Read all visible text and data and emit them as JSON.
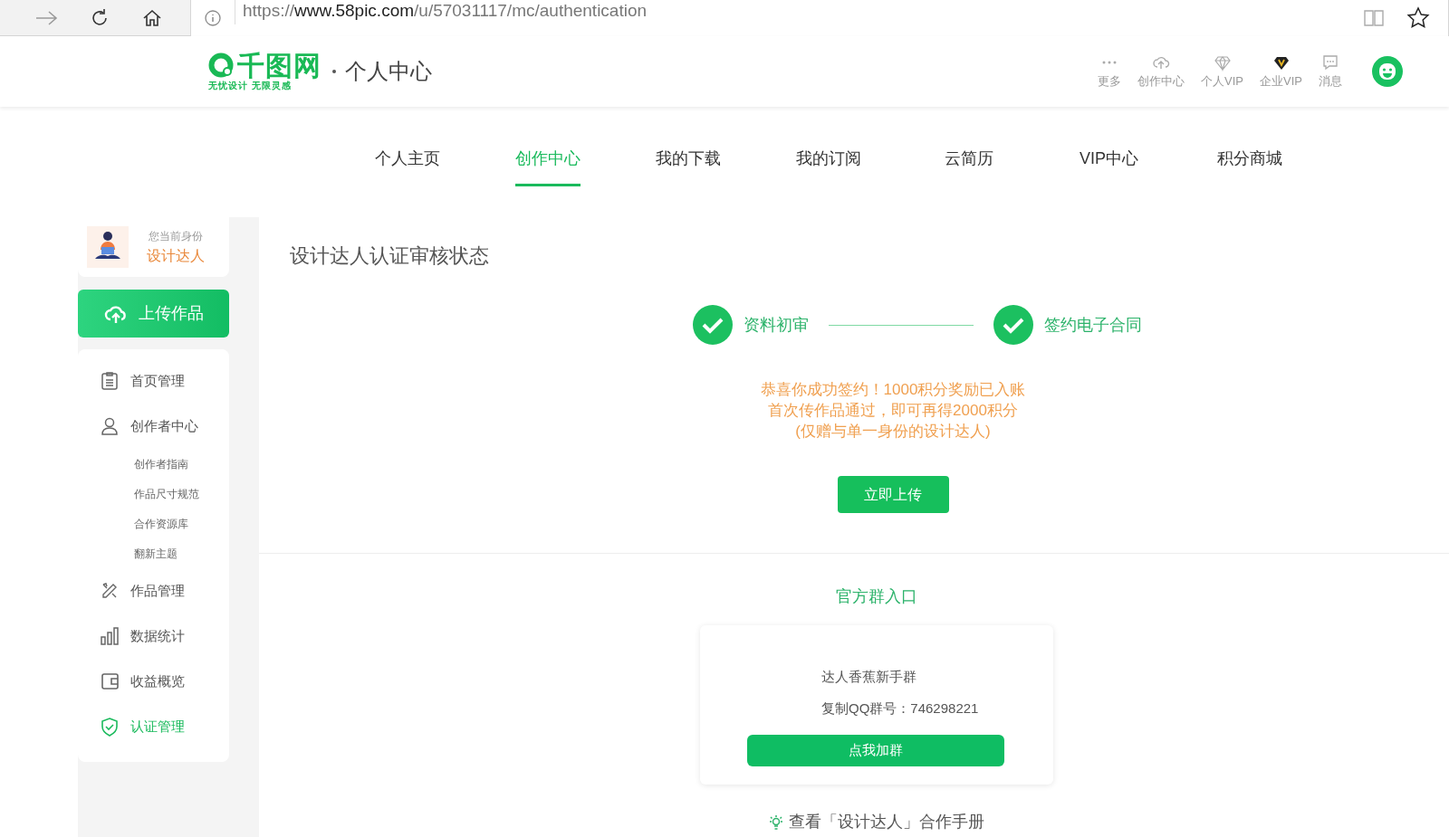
{
  "browser": {
    "url_prefix": "https://",
    "url_host": "www.58pic.com",
    "url_path": "/u/57031117/mc/authentication"
  },
  "header": {
    "logo": "千图网",
    "tagline": "无忧设计 无限灵感",
    "section": "个人中心",
    "actions": [
      {
        "kind": "more",
        "label": "更多"
      },
      {
        "kind": "upload",
        "label": "创作中心"
      },
      {
        "kind": "diamond",
        "label": "个人VIP"
      },
      {
        "kind": "vip",
        "label": "企业VIP"
      },
      {
        "kind": "message",
        "label": "消息"
      }
    ]
  },
  "tabs": [
    {
      "label": "个人主页",
      "selected": false
    },
    {
      "label": "创作中心",
      "selected": true
    },
    {
      "label": "我的下载",
      "selected": false
    },
    {
      "label": "我的订阅",
      "selected": false
    },
    {
      "label": "云简历",
      "selected": false
    },
    {
      "label": "VIP中心",
      "selected": false
    },
    {
      "label": "积分商城",
      "selected": false
    }
  ],
  "sidebar": {
    "identity_label": "您当前身份",
    "identity": "设计达人",
    "upload_button": "上传作品",
    "items": [
      {
        "kind": "clipboard",
        "label": "首页管理",
        "selected": false
      },
      {
        "kind": "user",
        "label": "创作者中心",
        "selected": false,
        "children": [
          {
            "label": "创作者指南"
          },
          {
            "label": "作品尺寸规范"
          },
          {
            "label": "合作资源库"
          },
          {
            "label": "翻新主题"
          }
        ]
      },
      {
        "kind": "tools",
        "label": "作品管理",
        "selected": false
      },
      {
        "kind": "bars",
        "label": "数据统计",
        "selected": false
      },
      {
        "kind": "wallet",
        "label": "收益概览",
        "selected": false
      },
      {
        "kind": "shield",
        "label": "认证管理",
        "selected": true
      }
    ]
  },
  "main": {
    "title": "设计达人认证审核状态",
    "steps": [
      {
        "label": "资料初审",
        "done": true
      },
      {
        "label": "签约电子合同",
        "done": true
      }
    ],
    "message": [
      "恭喜你成功签约！1000积分奖励已入账",
      "首次传作品通过，即可再得2000积分",
      "(仅赠与单一身份的设计达人)"
    ],
    "upload_button": "立即上传",
    "group": {
      "title": "官方群入口",
      "name": "达人香蕉新手群",
      "qq": "复制QQ群号：746298221",
      "join_button": "点我加群"
    },
    "manual_link": "查看「设计达人」合作手册"
  }
}
